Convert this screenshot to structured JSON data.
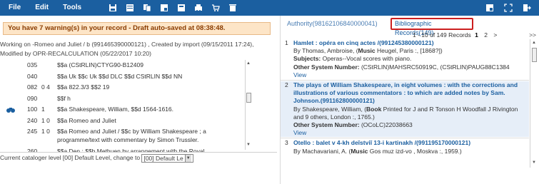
{
  "toolbar": {
    "menu": [
      "File",
      "Edit",
      "Tools"
    ],
    "icons": [
      "save-icon",
      "split-view-icon",
      "copy-icon",
      "records-icon",
      "templates-icon",
      "load-icon",
      "cart-icon",
      "trash-icon"
    ],
    "right_icons": [
      "window-icon",
      "expand-icon",
      "exit-icon"
    ],
    "bg_color": "#1b5fa0"
  },
  "warning": {
    "text": "You have 7 warning(s) in your record - Draft auto-saved at 08:38:48."
  },
  "working": {
    "line1": "Working on -Romeo and Juliet / b (991465390000121) , Created by import (09/15/2011 17:24),",
    "line2": "Modified by OPR-RECALCULATION (05/22/2017 10:20)"
  },
  "marc": [
    {
      "tag": "035",
      "ind": "",
      "value": "$$a (CStRLIN)CTYG90-B12409"
    },
    {
      "tag": "040",
      "ind": "",
      "value": "$$a Uk $$c Uk $$d DLC $$d CStRLIN $$d NN"
    },
    {
      "tag": "082",
      "ind": "0 4",
      "value": "$$a 822.3/3 $$2 19"
    },
    {
      "tag": "090",
      "ind": "",
      "value": "$$f h"
    },
    {
      "tag": "100",
      "ind": "1",
      "value": "$$a Shakespeare, William, $$d 1564-1616."
    },
    {
      "tag": "240",
      "ind": "1 0",
      "value": "$$a Romeo and Juliet"
    },
    {
      "tag": "245",
      "ind": "1 0",
      "value": "$$a Romeo and Juliet / $$c by William Shakespeare ; a programme/text with commentary by Simon Trussler."
    },
    {
      "tag": "260",
      "ind": "",
      "value": "$$a Den : $$b Methuen by arrangement with the Royal"
    }
  ],
  "level": {
    "label": "Current cataloger level [00] Default Level, change to",
    "selected": "[00] Default Le"
  },
  "tabs": {
    "authority": "Authority(98162106840000041)",
    "bib": "Bibliographic Records(149)"
  },
  "paging": {
    "summary": "1 - 10 of 149 Records",
    "current": "1",
    "next_page": "2",
    "next": ">",
    "last": ">>"
  },
  "results": [
    {
      "num": "1",
      "title": "Hamlet : opéra en cinq actes /(991245380000121)",
      "by": "By Thomas, Ambroise, (",
      "by_label": "Music",
      "by_rest": " Heugel, Paris :, [1868?])",
      "subjects_label": "Subjects:",
      "subjects": " Operas--Vocal scores with piano.",
      "other_label": "Other System Number:",
      "other": " (CStRLIN)MAHSRC50919C, (CStRLIN)PAUG88C1384",
      "view": "View"
    },
    {
      "num": "2",
      "title": "The plays of William Shakespeare, in eight volumes : with the corrections and illustrations of various commentators : to which are added notes by Sam. Johnson.(991162800000121)",
      "by": "By Shakespeare, William, (",
      "by_label": "Book",
      "by_rest": " Printed for J and R Tonson H Woodfall J Rivington and 9 others, London :, 1765.)",
      "other_label": "Other System Number:",
      "other": " (OCoLC)22038663",
      "view": "View"
    },
    {
      "num": "3",
      "title": "Otello : balet v 4-kh deĭstviĭ 13-i kartinakh /(991195170000121)",
      "by": "By Machavariani, A. (",
      "by_label": "Music",
      "by_rest": " Gos muz izd-vo , Moskva :, 1959.)"
    }
  ],
  "colors": {
    "highlight_border": "#cc1f1f",
    "link": "#1b5fa0",
    "warning_bg": "#fde5c7"
  }
}
